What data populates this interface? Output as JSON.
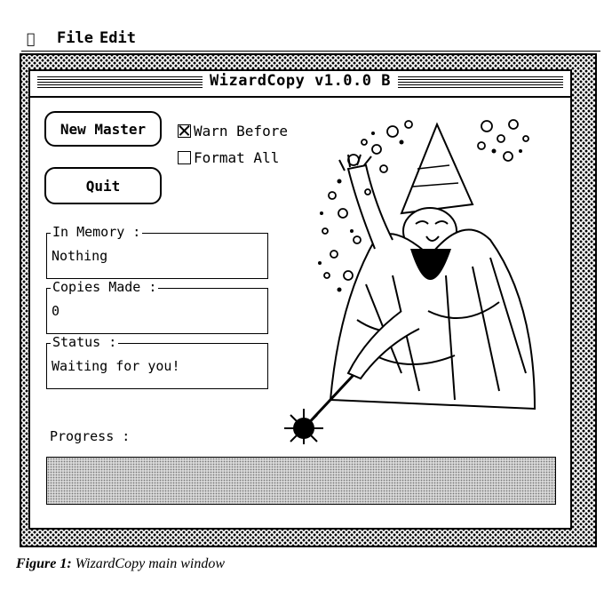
{
  "menubar": {
    "apple": "",
    "items": [
      "File",
      "Edit"
    ]
  },
  "window": {
    "title": "WizardCopy v1.0.0 B"
  },
  "buttons": {
    "new_master": "New Master",
    "quit": "Quit"
  },
  "options": {
    "warn_before": {
      "label": "Warn Before",
      "checked": true
    },
    "format_all": {
      "label": "Format All",
      "checked": false
    }
  },
  "groups": {
    "in_memory": {
      "label": "In Memory :",
      "value": "Nothing"
    },
    "copies_made": {
      "label": "Copies Made :",
      "value": "0"
    },
    "status": {
      "label": "Status :",
      "value": "Waiting for you!"
    }
  },
  "progress": {
    "label": "Progress :",
    "value": 0
  },
  "caption": {
    "label": "Figure 1:",
    "text": "WizardCopy main window"
  }
}
